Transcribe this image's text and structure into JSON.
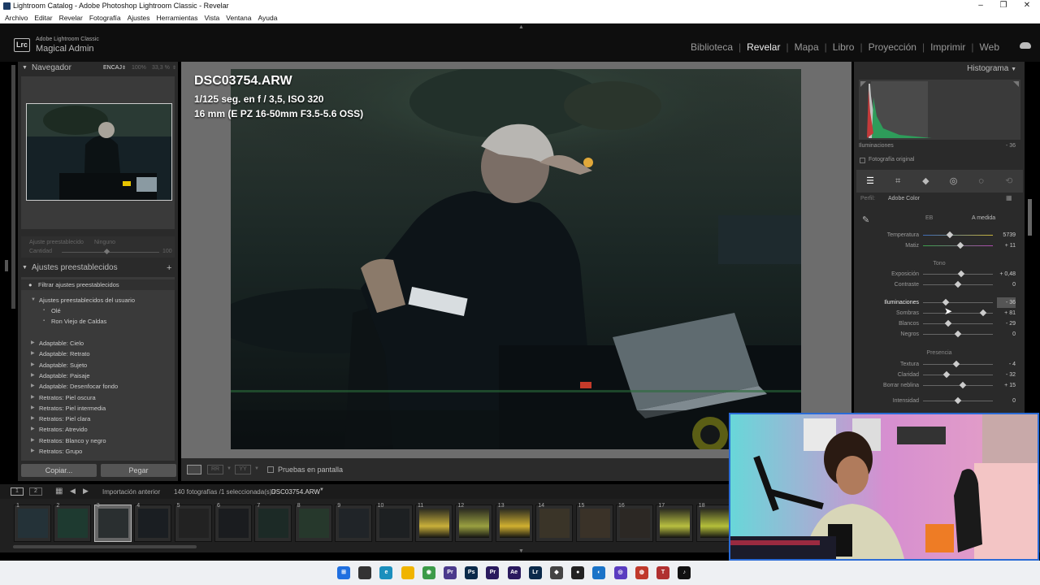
{
  "window": {
    "title": "Lightroom Catalog - Adobe Photoshop Lightroom Classic - Revelar"
  },
  "menu": [
    "Archivo",
    "Editar",
    "Revelar",
    "Fotografía",
    "Ajustes",
    "Herramientas",
    "Vista",
    "Ventana",
    "Ayuda"
  ],
  "brand": {
    "app": "Adobe Lightroom Classic",
    "user": "Magical Admin"
  },
  "modules": [
    "Biblioteca",
    "Revelar",
    "Mapa",
    "Libro",
    "Proyección",
    "Imprimir",
    "Web"
  ],
  "active_module": "Revelar",
  "navigator": {
    "title": "Navegador",
    "zoom_options": [
      "ENCAJ",
      "100%",
      "33,3 %"
    ]
  },
  "preset_amount": {
    "label": "Ajuste preestablecido",
    "value": "Ninguno",
    "amount_label": "Cantidad",
    "amount": "100"
  },
  "presets": {
    "title": "Ajustes preestablecidos",
    "filter": "Filtrar ajustes preestablecidos",
    "user_group": "Ajustes preestablecidos del usuario",
    "user_items": [
      "Olé",
      "Ron Viejo de Caldas"
    ],
    "groups": [
      "Adaptable: Cielo",
      "Adaptable: Retrato",
      "Adaptable: Sujeto",
      "Adaptable: Paisaje",
      "Adaptable: Desenfocar fondo",
      "Retratos: Piel oscura",
      "Retratos: Piel intermedia",
      "Retratos: Piel clara",
      "Retratos: Atrevido",
      "Retratos: Blanco y negro",
      "Retratos: Grupo"
    ]
  },
  "buttons": {
    "copy": "Copiar...",
    "paste": "Pegar"
  },
  "photo_info": {
    "filename": "DSC03754.ARW",
    "exposure": "1/125 seg. en f / 3,5, ISO 320",
    "lens": "16 mm (E PZ 16-50mm F3.5-5.6 OSS)"
  },
  "toolbar": {
    "soft_proof": "Pruebas en pantalla"
  },
  "histogram": {
    "title": "Histograma",
    "hover_label": "Iluminaciones",
    "hover_value": "- 36",
    "original": "Fotografía original"
  },
  "basic": {
    "profile_label": "Perfil:",
    "profile": "Adobe Color",
    "wb_label": "EB",
    "wb_value": "A medida",
    "tone_label": "Tono",
    "presence_label": "Presencia",
    "sliders": [
      {
        "name": "Temperatura",
        "value": "5739",
        "pos": 0.38
      },
      {
        "name": "Matiz",
        "value": "+ 11",
        "pos": 0.53
      },
      {
        "name": "Exposición",
        "value": "+ 0,48",
        "pos": 0.55
      },
      {
        "name": "Contraste",
        "value": "0",
        "pos": 0.5
      },
      {
        "name": "Iluminaciones",
        "value": "- 36",
        "pos": 0.32
      },
      {
        "name": "Sombras",
        "value": "+ 81",
        "pos": 0.86
      },
      {
        "name": "Blancos",
        "value": "- 29",
        "pos": 0.36
      },
      {
        "name": "Negros",
        "value": "0",
        "pos": 0.5
      },
      {
        "name": "Textura",
        "value": "- 4",
        "pos": 0.48
      },
      {
        "name": "Claridad",
        "value": "- 32",
        "pos": 0.34
      },
      {
        "name": "Borrar neblina",
        "value": "+ 15",
        "pos": 0.57
      },
      {
        "name": "Intensidad",
        "value": "0",
        "pos": 0.5
      }
    ]
  },
  "filmstrip": {
    "source": "Importación anterior",
    "count": "140 fotografías /1 seleccionada(s) /",
    "current": "DSC03754.ARW",
    "numbers": [
      "1",
      "2",
      "3",
      "4",
      "5",
      "6",
      "7",
      "8",
      "9",
      "10",
      "11",
      "12",
      "13",
      "14",
      "15",
      "16",
      "17",
      "18"
    ]
  },
  "taskbar": {
    "apps": [
      {
        "name": "windows-start",
        "color": "#1f6fe0",
        "label": "⊞"
      },
      {
        "name": "app-dark",
        "color": "#333333",
        "label": ""
      },
      {
        "name": "edge",
        "color": "#1b8fbd",
        "label": "e"
      },
      {
        "name": "explorer",
        "color": "#f0b400",
        "label": ""
      },
      {
        "name": "chrome",
        "color": "#3c9b49",
        "label": "◉"
      },
      {
        "name": "premiere-dark",
        "color": "#4b3a8c",
        "label": "Pr"
      },
      {
        "name": "photoshop",
        "color": "#0b2a4a",
        "label": "Ps"
      },
      {
        "name": "premiere",
        "color": "#2a1a5e",
        "label": "Pr"
      },
      {
        "name": "after-effects",
        "color": "#2a1a5e",
        "label": "Ae"
      },
      {
        "name": "lightroom",
        "color": "#0b2a4a",
        "label": "Lr"
      },
      {
        "name": "resolve",
        "color": "#444444",
        "label": "◆"
      },
      {
        "name": "github",
        "color": "#222222",
        "label": "●"
      },
      {
        "name": "app-blue",
        "color": "#1a73c8",
        "label": "◐"
      },
      {
        "name": "app-purple",
        "color": "#5a3cc0",
        "label": "◎"
      },
      {
        "name": "app-red",
        "color": "#c0392b",
        "label": "◍"
      },
      {
        "name": "app-text",
        "color": "#b03030",
        "label": "T"
      },
      {
        "name": "tiktok",
        "color": "#111111",
        "label": "♪"
      }
    ]
  }
}
